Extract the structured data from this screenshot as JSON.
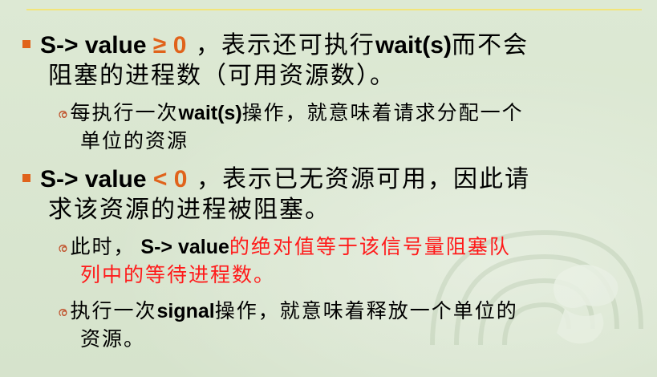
{
  "slide": {
    "sections": [
      {
        "point": {
          "lead": "S-> value ",
          "relation": "≥ 0",
          "rest_line1": " ，表示还可执行",
          "code": "wait(s)",
          "rest_line1b": "而不会",
          "line2": "阻塞的进程数（可用资源数）。"
        },
        "sub": [
          {
            "prefix": "每执行一次",
            "code": "wait(s)",
            "rest_line1": "操作，就意味着请求分配一个",
            "line2": "单位的资源"
          }
        ]
      },
      {
        "point": {
          "lead": "S-> value ",
          "relation": "< 0",
          "rest_line1": " ，表示已无资源可用，因此请",
          "line2": "求该资源的进程被阻塞。"
        },
        "sub": [
          {
            "prefix": "此时，",
            "code": " S-> value",
            "rest_line1": "的绝对值等于该信号量阻塞队",
            "line2": "列中的等待进程数。"
          },
          {
            "prefix": "执行一次",
            "code": "signal",
            "rest_line1": "操作，就意味着释放一个单位的",
            "line2": "资源。"
          }
        ]
      }
    ]
  },
  "colors": {
    "background": "#d9e6d0",
    "accent": "#e0631b",
    "highlight_red": "#ff1a1a",
    "rule": "#f2e57a"
  },
  "icons": {
    "bullet": "square-bullet",
    "sub_bullet": "curly-sub-bullet"
  }
}
